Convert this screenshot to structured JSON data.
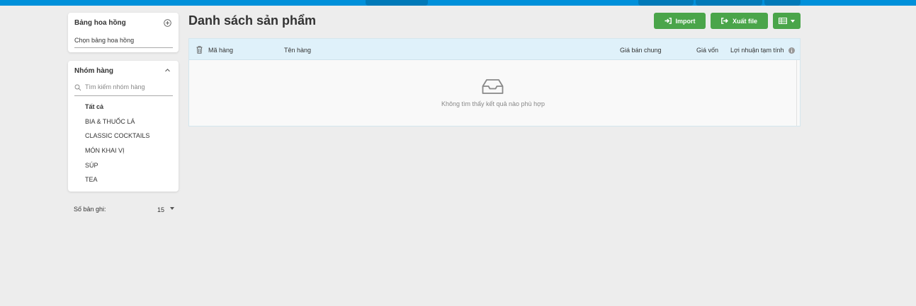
{
  "sidebar": {
    "commission": {
      "title": "Bảng hoa hồng",
      "placeholder": "Chọn bảng hoa hồng"
    },
    "groups": {
      "title": "Nhóm hàng",
      "search_placeholder": "Tìm kiếm nhóm hàng",
      "items": [
        {
          "label": "Tất cả",
          "active": true
        },
        {
          "label": "BIA & THUỐC LÁ"
        },
        {
          "label": "CLASSIC COCKTAILS"
        },
        {
          "label": "MÓN KHAI VỊ"
        },
        {
          "label": "SÚP"
        },
        {
          "label": "TEA"
        }
      ]
    },
    "records": {
      "label": "Số bản ghi:",
      "value": "15"
    }
  },
  "main": {
    "title": "Danh sách sản phẩm",
    "buttons": {
      "import": "Import",
      "export": "Xuất file"
    },
    "table": {
      "columns": [
        "Mã hàng",
        "Tên hàng",
        "Giá bán chung",
        "Giá vốn",
        "Lợi nhuận tạm tính"
      ],
      "empty_message": "Không tìm thấy kết quả nào phù hợp"
    }
  },
  "colors": {
    "topbar": "#0090da",
    "accent_button": "#4aa54a",
    "table_header": "#dff1fa"
  },
  "icons": [
    "plus-circle-icon",
    "chevron-up-icon",
    "search-icon",
    "caret-down-icon",
    "import-icon",
    "export-icon",
    "list-view-icon",
    "trash-icon",
    "info-icon",
    "inbox-icon"
  ]
}
